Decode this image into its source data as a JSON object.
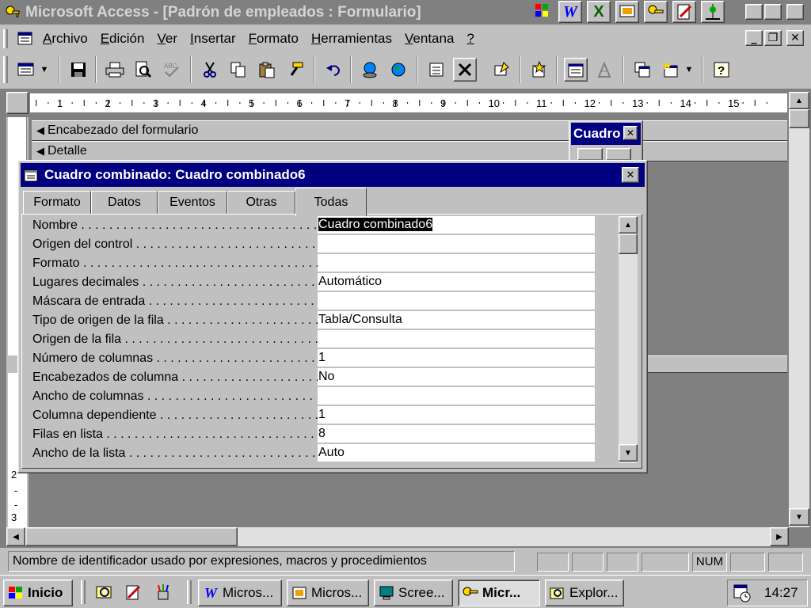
{
  "window": {
    "title": "Microsoft Access - [Padrón de empleados : Formulario]"
  },
  "title_tray_icons": [
    "windows-logo-icon",
    "word-icon",
    "excel-icon",
    "powerpoint-icon",
    "access-icon",
    "notepad-icon",
    "office-assistant-icon"
  ],
  "menu": {
    "items": [
      {
        "label": "Archivo",
        "accel": "A"
      },
      {
        "label": "Edición",
        "accel": "E"
      },
      {
        "label": "Ver",
        "accel": "V"
      },
      {
        "label": "Insertar",
        "accel": "I"
      },
      {
        "label": "Formato",
        "accel": "F"
      },
      {
        "label": "Herramientas",
        "accel": "H"
      },
      {
        "label": "Ventana",
        "accel": "V"
      },
      {
        "label": "?",
        "accel": "?"
      }
    ]
  },
  "ruler": {
    "marks": [
      "1",
      "2",
      "3",
      "4",
      "5",
      "6",
      "7",
      "8",
      "9",
      "10",
      "11",
      "12",
      "13",
      "14",
      "15"
    ]
  },
  "form": {
    "header_section": "Encabezado del formulario",
    "detail_section": "Detalle",
    "toolbox_title": "Cuadro"
  },
  "properties": {
    "title": "Cuadro combinado: Cuadro combinado6",
    "tabs": [
      "Formato",
      "Datos",
      "Eventos",
      "Otras",
      "Todas"
    ],
    "active_tab": "Todas",
    "rows": [
      {
        "label": "Nombre",
        "value": "Cuadro combinado6"
      },
      {
        "label": "Origen del control",
        "value": ""
      },
      {
        "label": "Formato",
        "value": ""
      },
      {
        "label": "Lugares decimales",
        "value": "Automático"
      },
      {
        "label": "Máscara de entrada",
        "value": ""
      },
      {
        "label": "Tipo de origen de la fila",
        "value": "Tabla/Consulta"
      },
      {
        "label": "Origen de la fila",
        "value": ""
      },
      {
        "label": "Número de columnas",
        "value": "1"
      },
      {
        "label": "Encabezados de columna",
        "value": "No"
      },
      {
        "label": "Ancho de columnas",
        "value": ""
      },
      {
        "label": "Columna dependiente",
        "value": "1"
      },
      {
        "label": "Filas en lista",
        "value": "8"
      },
      {
        "label": "Ancho de la lista",
        "value": "Auto"
      }
    ]
  },
  "vertical_ruler_marks": [
    "2",
    "3"
  ],
  "statusbar": {
    "message": "Nombre de identificador usado por expresiones, macros y procedimientos",
    "num_indicator": "NUM"
  },
  "taskbar": {
    "start_label": "Inicio",
    "tasks": [
      {
        "label": "Micros...",
        "icon": "word-icon"
      },
      {
        "label": "Micros...",
        "icon": "powerpoint-icon"
      },
      {
        "label": "Scree...",
        "icon": "monitor-icon"
      },
      {
        "label": "Micr...",
        "icon": "access-key-icon",
        "active": true
      },
      {
        "label": "Explor...",
        "icon": "explorer-icon"
      }
    ],
    "clock": "14:27"
  },
  "colors": {
    "title_active": "#000080",
    "title_inactive": "#808080",
    "face": "#c0c0c0",
    "workspace": "#808080"
  }
}
